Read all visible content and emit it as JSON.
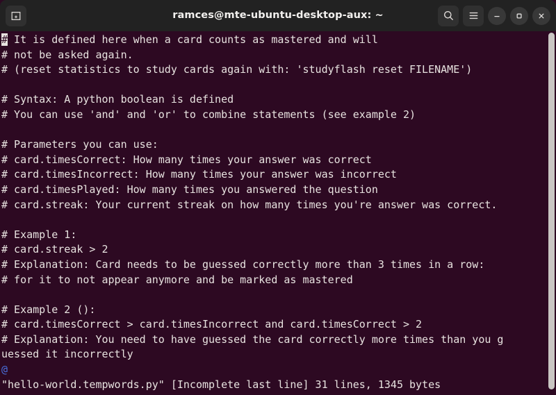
{
  "window": {
    "title": "ramces@mte-ubuntu-desktop-aux: ~",
    "titlebar_bg": "#222222",
    "terminal_bg": "#2d0922",
    "terminal_fg": "#e8e3e0",
    "accent_blue": "#4a6fdc"
  },
  "titlebar": {
    "new_tab_label": "new-tab",
    "search_label": "search",
    "menu_label": "menu",
    "minimize_label": "minimize",
    "maximize_label": "maximize",
    "close_label": "close"
  },
  "terminal": {
    "cursor_char": "#",
    "lines": [
      {
        "text": " It is defined here when a card counts as mastered and will",
        "cursor": true,
        "color": "fg"
      },
      {
        "text": "# not be asked again.",
        "cursor": false,
        "color": "fg"
      },
      {
        "text": "# (reset statistics to study cards again with: 'studyflash reset FILENAME')",
        "cursor": false,
        "color": "fg"
      },
      {
        "text": "",
        "cursor": false,
        "color": "fg"
      },
      {
        "text": "# Syntax: A python boolean is defined",
        "cursor": false,
        "color": "fg"
      },
      {
        "text": "# You can use 'and' and 'or' to combine statements (see example 2)",
        "cursor": false,
        "color": "fg"
      },
      {
        "text": "",
        "cursor": false,
        "color": "fg"
      },
      {
        "text": "# Parameters you can use:",
        "cursor": false,
        "color": "fg"
      },
      {
        "text": "# card.timesCorrect: How many times your answer was correct",
        "cursor": false,
        "color": "fg"
      },
      {
        "text": "# card.timesIncorrect: How many times your answer was incorrect",
        "cursor": false,
        "color": "fg"
      },
      {
        "text": "# card.timesPlayed: How many times you answered the question",
        "cursor": false,
        "color": "fg"
      },
      {
        "text": "# card.streak: Your current streak on how many times you're answer was correct.",
        "cursor": false,
        "color": "fg"
      },
      {
        "text": "",
        "cursor": false,
        "color": "fg"
      },
      {
        "text": "# Example 1:",
        "cursor": false,
        "color": "fg"
      },
      {
        "text": "# card.streak > 2",
        "cursor": false,
        "color": "fg"
      },
      {
        "text": "# Explanation: Card needs to be guessed correctly more than 3 times in a row:",
        "cursor": false,
        "color": "fg"
      },
      {
        "text": "# for it to not appear anymore and be marked as mastered",
        "cursor": false,
        "color": "fg"
      },
      {
        "text": "",
        "cursor": false,
        "color": "fg"
      },
      {
        "text": "# Example 2 ():",
        "cursor": false,
        "color": "fg"
      },
      {
        "text": "# card.timesCorrect > card.timesIncorrect and card.timesCorrect > 2",
        "cursor": false,
        "color": "fg"
      },
      {
        "text": "# Explanation: You need to have guessed the card correctly more times than you g",
        "cursor": false,
        "color": "fg"
      },
      {
        "text": "uessed it incorrectly",
        "cursor": false,
        "color": "fg"
      },
      {
        "text": "@",
        "cursor": false,
        "color": "blue"
      },
      {
        "text": "\"hello-world.tempwords.py\" [Incomplete last line] 31 lines, 1345 bytes",
        "cursor": false,
        "color": "fg"
      }
    ],
    "status_filename": "hello-world.tempwords.py",
    "status_note": "[Incomplete last line]",
    "status_lines": "31 lines",
    "status_bytes": "1345 bytes"
  },
  "scrollbar": {
    "position_label": "scrollbar"
  }
}
